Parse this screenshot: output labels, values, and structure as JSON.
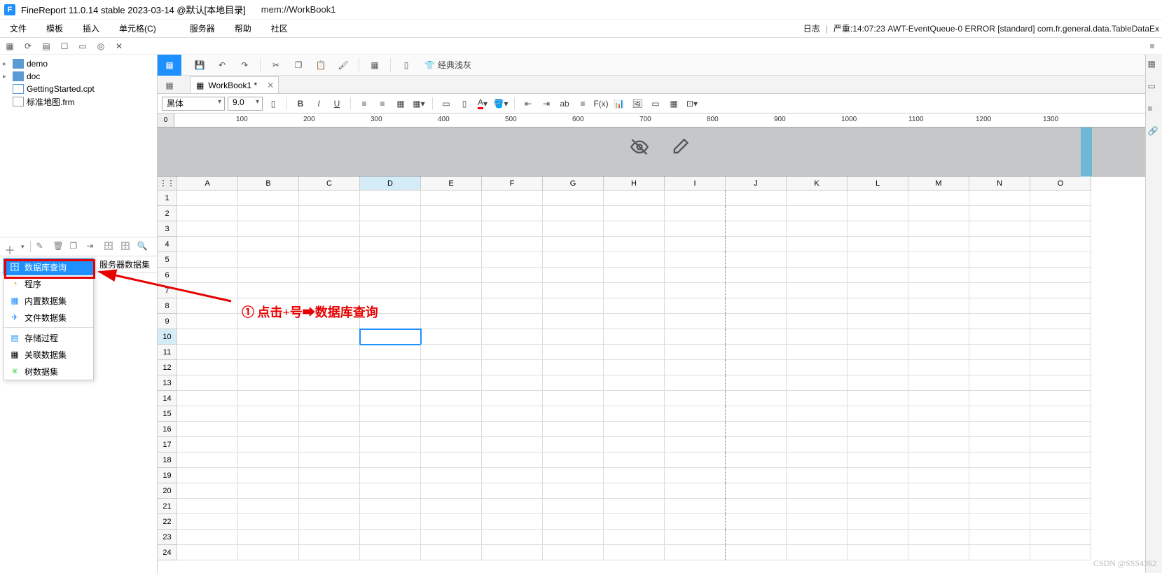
{
  "title": {
    "app": "FineReport 11.0.14 stable 2023-03-14 @默认[本地目录]",
    "doc": "mem://WorkBook1"
  },
  "menu": {
    "items": [
      "文件",
      "模板",
      "插入",
      "单元格(C)",
      "服务器",
      "帮助",
      "社区"
    ],
    "log_label": "日志",
    "log_msg": "严重:14:07:23 AWT-EventQueue-0 ERROR [standard] com.fr.general.data.TableDataEx"
  },
  "tree": {
    "items": [
      {
        "label": "demo",
        "type": "folder"
      },
      {
        "label": "doc",
        "type": "folder"
      },
      {
        "label": "GettingStarted.cpt",
        "type": "file"
      },
      {
        "label": "标准地图.frm",
        "type": "file2"
      }
    ]
  },
  "ds_tabs": {
    "right": "服务器数据集"
  },
  "ds_menu": {
    "items": [
      {
        "label": "数据库查询",
        "icon": "db",
        "selected": true
      },
      {
        "label": "程序",
        "icon": "prog"
      },
      {
        "label": "内置数据集",
        "icon": "builtin"
      },
      {
        "label": "文件数据集",
        "icon": "filed"
      },
      {
        "sep": true
      },
      {
        "label": "存储过程",
        "icon": "proc"
      },
      {
        "label": "关联数据集",
        "icon": "join"
      },
      {
        "label": "树数据集",
        "icon": "tree"
      }
    ]
  },
  "toolbar": {
    "theme": "经典浅灰"
  },
  "tab": {
    "name": "WorkBook1 *"
  },
  "format": {
    "font": "黑体",
    "size": "9.0"
  },
  "ruler_ticks": [
    "100",
    "200",
    "300",
    "400",
    "500",
    "600",
    "700",
    "800",
    "900",
    "1000",
    "1100",
    "1200",
    "1300"
  ],
  "columns": [
    "A",
    "B",
    "C",
    "D",
    "E",
    "F",
    "G",
    "H",
    "I",
    "J",
    "K",
    "L",
    "M",
    "N",
    "O"
  ],
  "selected_col": "D",
  "selected_row": 10,
  "num_rows": 24,
  "ruler_zero": "0",
  "annotation": "① 点击+号➡数据库查询",
  "watermark": "CSDN @SSS4362"
}
